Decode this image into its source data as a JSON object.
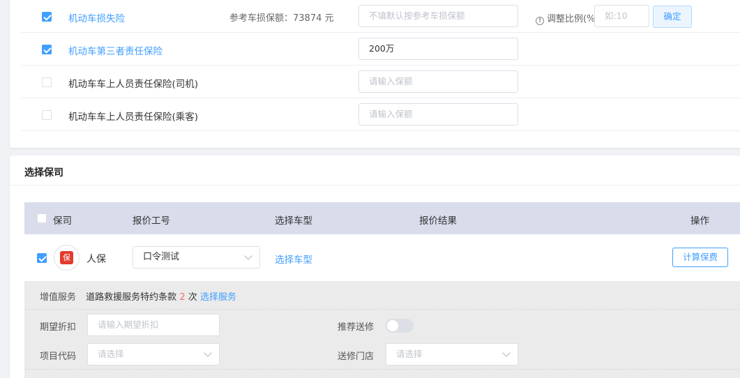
{
  "coverage": {
    "rows": [
      {
        "name": "机动车损失险",
        "checked": true,
        "ref_label": "参考车损保额：73874 元",
        "input_placeholder": "不填默认按参考车损保额",
        "adjust_label": "调整比例(%)",
        "adjust_placeholder": "如:10",
        "confirm_label": "确定"
      },
      {
        "name": "机动车第三者责任保险",
        "checked": true,
        "input_value": "200万"
      },
      {
        "name": "机动车车上人员责任保险(司机)",
        "checked": false,
        "input_placeholder": "请输入保额"
      },
      {
        "name": "机动车车上人员责任保险(乘客)",
        "checked": false,
        "input_placeholder": "请输入保额"
      }
    ]
  },
  "insurer_section": {
    "title": "选择保司",
    "columns": [
      "保司",
      "报价工号",
      "选择车型",
      "报价结果",
      "操作"
    ],
    "row": {
      "checked": true,
      "logo_glyph": "保",
      "name": "人保",
      "quote_account": "口令测试",
      "choose_model_link": "选择车型",
      "result": "",
      "calc_button": "计算保费"
    },
    "extra": {
      "vas_label": "增值服务",
      "vas_text": "道路救援服务特约条款",
      "vas_count": "2",
      "vas_unit": "次",
      "vas_link": "选择服务",
      "discount_label": "期望折扣",
      "discount_placeholder": "请输入期望折扣",
      "recommend_label": "推荐送修",
      "recommend_on": false,
      "project_label": "项目代码",
      "project_placeholder": "请选择",
      "shop_label": "送修门店",
      "shop_placeholder": "请选择"
    }
  },
  "colors": {
    "primary": "#409eff",
    "header_bg": "#d9dceb",
    "danger": "#f56c6c"
  }
}
